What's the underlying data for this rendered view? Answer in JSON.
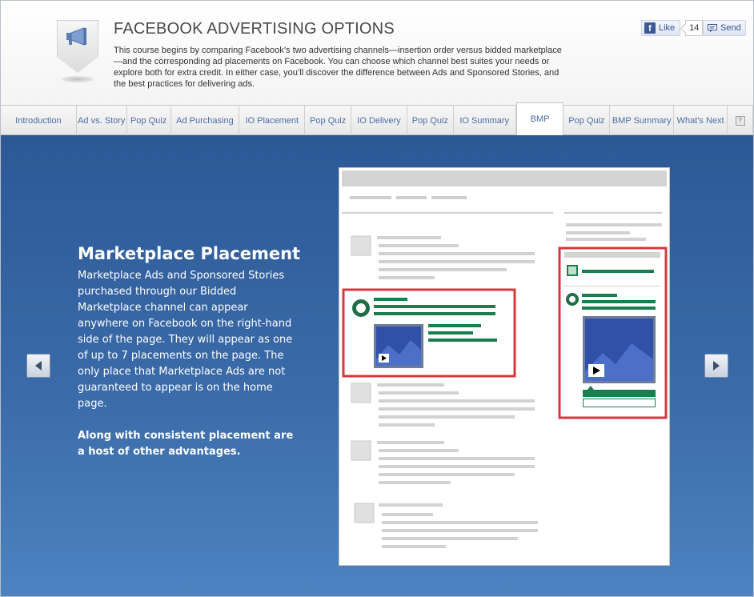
{
  "header": {
    "title": "FACEBOOK ADVERTISING OPTIONS",
    "intro": "This course begins by comparing Facebook’s two advertising channels—insertion order versus bidded marketplace—and the corresponding ad placements on Facebook. You can choose which channel best suites your needs or explore both for extra credit. In either case, you’ll discover the difference between Ads and Sponsored Stories, and the best practices for delivering ads.",
    "badge_icon": "megaphone-icon"
  },
  "social": {
    "like_label": "Like",
    "like_count": "14",
    "send_label": "Send",
    "brand_color": "#3b5998"
  },
  "tabs": [
    {
      "label": "Introduction"
    },
    {
      "label": "Ad vs. Story"
    },
    {
      "label": "Pop Quiz"
    },
    {
      "label": "Ad Purchasing"
    },
    {
      "label": "IO Placement"
    },
    {
      "label": "Pop Quiz"
    },
    {
      "label": "IO Delivery"
    },
    {
      "label": "Pop Quiz"
    },
    {
      "label": "IO Summary"
    },
    {
      "label": "BMP",
      "active": true
    },
    {
      "label": "Pop Quiz"
    },
    {
      "label": "BMP Summary"
    },
    {
      "label": "What's Next"
    }
  ],
  "help": {
    "label": "?"
  },
  "slide": {
    "title": "Marketplace Placement",
    "paragraph1": "Marketplace Ads and Sponsored Stories purchased through our Bidded Marketplace channel can appear anywhere on Facebook on the right-hand side of the page. They will appear as one of up to 7 placements on the page. The only place that Marketplace Ads are not guaranteed to appear is on the home page.",
    "paragraph2": "Along with consistent placement are a host of other advantages."
  },
  "colors": {
    "background_top": "#2c5896",
    "background_bottom": "#4c83c0",
    "highlight_box": "#d9373d",
    "ad_text_lines": "#1a7f4e",
    "video_thumb": "#3150a8"
  }
}
